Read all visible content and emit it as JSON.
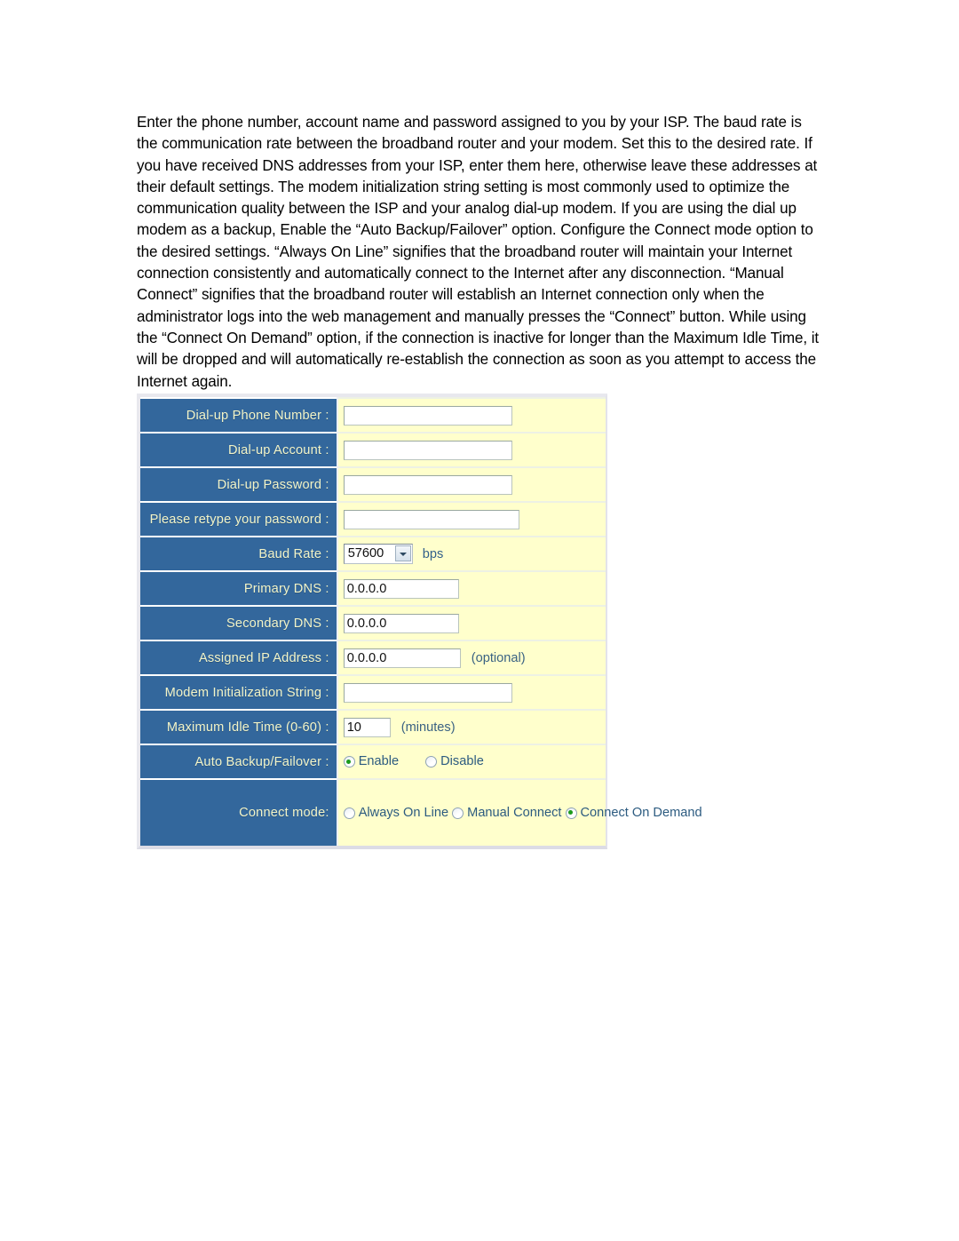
{
  "document": {
    "paragraph": "Enter the phone number, account name and password assigned to you by your ISP. The baud rate is the communication rate between the broadband router and your modem. Set this to the desired rate. If you have received DNS addresses from your ISP, enter them here, otherwise leave these addresses at their default settings. The modem initialization string setting is most commonly used to optimize the communication quality between the ISP and your analog dial-up modem. If you are using the dial up modem as a backup, Enable the “Auto Backup/Failover” option. Configure the Connect mode option to the desired settings. “Always On Line” signifies that the broadband router will maintain your Internet connection consistently and automatically connect to the Internet after any disconnection. “Manual Connect” signifies that the broadband router will establish an Internet connection only when the administrator logs into the web management and manually presses the “Connect” button. While using the “Connect On Demand” option, if the connection is inactive for longer than the Maximum Idle Time, it will be dropped and will automatically re-establish the connection as soon as you attempt to access the Internet again."
  },
  "colors": {
    "label_background": "#33679c",
    "label_text": "#f2f4c8",
    "field_background": "#ffffcc",
    "field_text": "#2b4d66",
    "radio_dot": "#1c9b1c",
    "frame_border": "#e8e8ee"
  },
  "form": {
    "rows": [
      {
        "label": "Dial-up Phone Number :",
        "value": "",
        "placeholder": ""
      },
      {
        "label": "Dial-up Account :",
        "value": "",
        "placeholder": ""
      },
      {
        "label": "Dial-up Password :",
        "value": "",
        "placeholder": ""
      },
      {
        "label": "Please retype your password :",
        "value": "",
        "placeholder": ""
      },
      {
        "label": "Baud Rate :",
        "value": "57600",
        "unit": "bps"
      },
      {
        "label": "Primary DNS :",
        "value": "0.0.0.0"
      },
      {
        "label": "Secondary DNS :",
        "value": "0.0.0.0"
      },
      {
        "label": "Assigned IP Address :",
        "value": "0.0.0.0",
        "note": "(optional)"
      },
      {
        "label": "Modem Initialization String :",
        "value": "",
        "placeholder": ""
      },
      {
        "label": "Maximum Idle Time (0-60) :",
        "value": "10",
        "note": "(minutes)"
      },
      {
        "label": "Auto Backup/Failover :"
      },
      {
        "label": "Connect mode:"
      }
    ],
    "baud_rate": {
      "label": "Baud Rate :",
      "selected": "57600",
      "unit": "bps",
      "options": [
        "57600"
      ]
    },
    "auto_backup": {
      "label": "Auto Backup/Failover :",
      "options": [
        {
          "label": "Enable",
          "checked": true
        },
        {
          "label": "Disable",
          "checked": false
        }
      ]
    },
    "connect_mode": {
      "label": "Connect mode:",
      "options": [
        {
          "label": "Always On Line",
          "checked": false
        },
        {
          "label": "Manual Connect",
          "checked": false
        },
        {
          "label": "Connect On Demand",
          "checked": true
        }
      ]
    }
  }
}
